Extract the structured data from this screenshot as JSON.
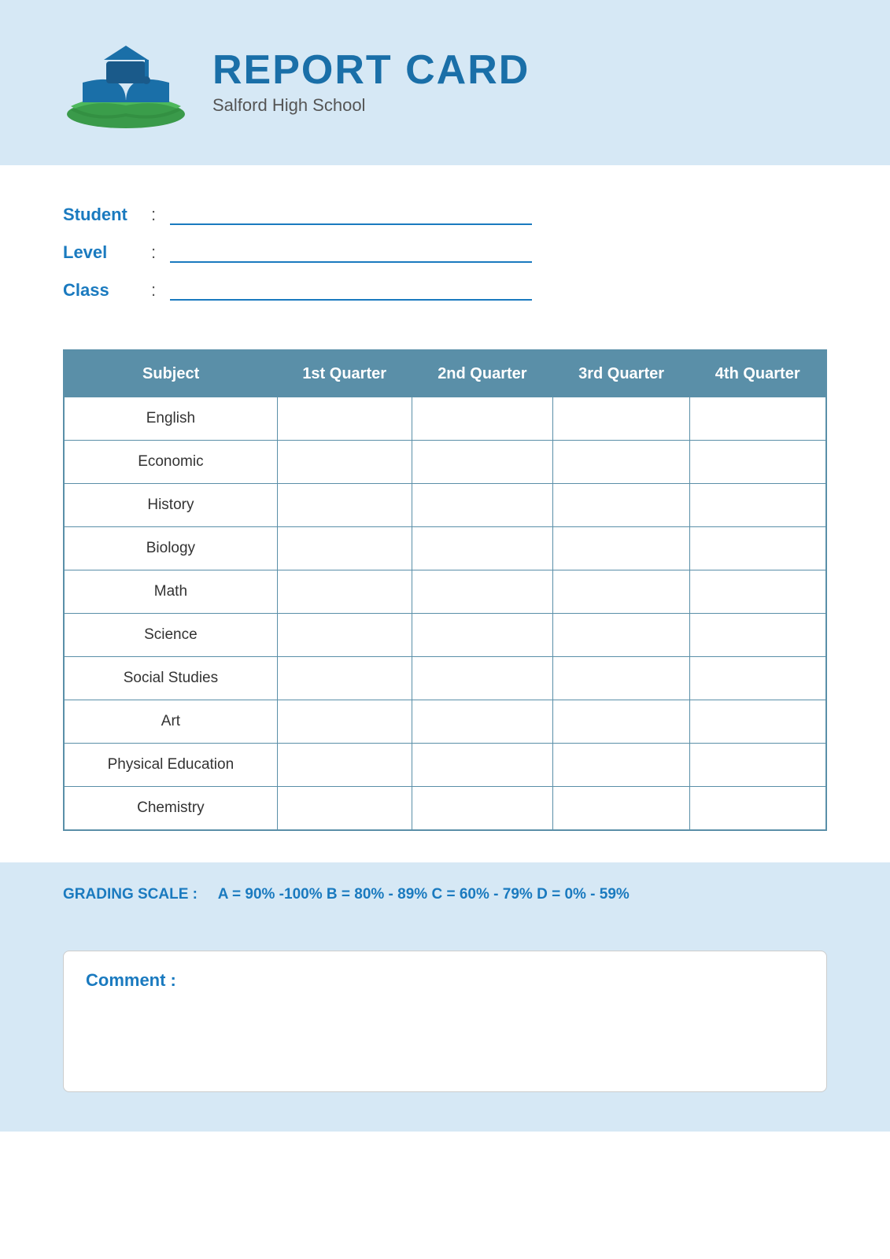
{
  "header": {
    "title": "REPORT CARD",
    "subtitle": "Salford High School"
  },
  "info": {
    "student_label": "Student",
    "level_label": "Level",
    "class_label": "Class",
    "colon": ":"
  },
  "table": {
    "headers": [
      "Subject",
      "1st Quarter",
      "2nd Quarter",
      "3rd Quarter",
      "4th Quarter"
    ],
    "rows": [
      {
        "subject": "English"
      },
      {
        "subject": "Economic"
      },
      {
        "subject": "History"
      },
      {
        "subject": "Biology"
      },
      {
        "subject": "Math"
      },
      {
        "subject": "Science"
      },
      {
        "subject": "Social Studies"
      },
      {
        "subject": "Art"
      },
      {
        "subject": "Physical Education"
      },
      {
        "subject": "Chemistry"
      }
    ]
  },
  "grading": {
    "label": "GRADING SCALE :",
    "values": "A = 90% -100%  B = 80% - 89%  C = 60% - 79%  D = 0% - 59%"
  },
  "comment": {
    "label": "Comment :"
  }
}
